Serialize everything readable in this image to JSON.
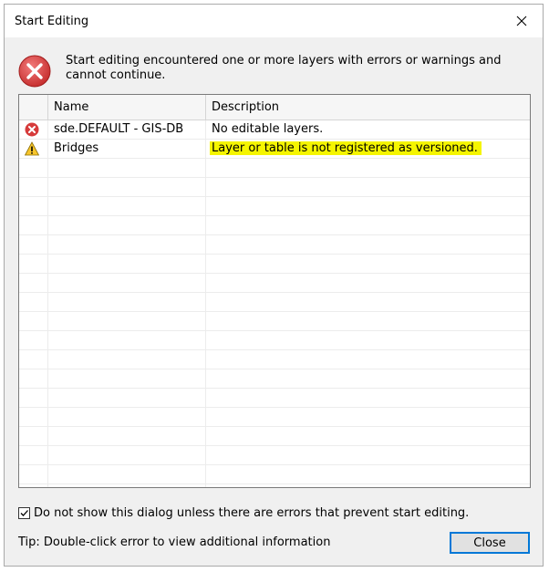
{
  "dialog": {
    "title": "Start Editing",
    "message": "Start editing encountered one or more layers with errors or warnings and cannot continue."
  },
  "grid": {
    "columns": [
      "",
      "Name",
      "Description"
    ],
    "rows": [
      {
        "icon": "error-icon",
        "name": "sde.DEFAULT - GIS-DB",
        "description": "No editable layers.",
        "highlighted": false
      },
      {
        "icon": "warning-icon",
        "name": "Bridges",
        "description": "Layer or table is not registered as versioned.",
        "highlighted": true
      }
    ],
    "empty_row_count": 18
  },
  "footer": {
    "checkbox_label": "Do not show this dialog unless there are errors that prevent start editing.",
    "checkbox_checked": true,
    "tip": "Tip: Double-click error to view additional information",
    "close_button": "Close"
  },
  "colors": {
    "error_red": "#d63b3b",
    "warning_yellow": "#f7c52b",
    "highlight": "#f5f500",
    "accent_blue": "#0078d7"
  }
}
